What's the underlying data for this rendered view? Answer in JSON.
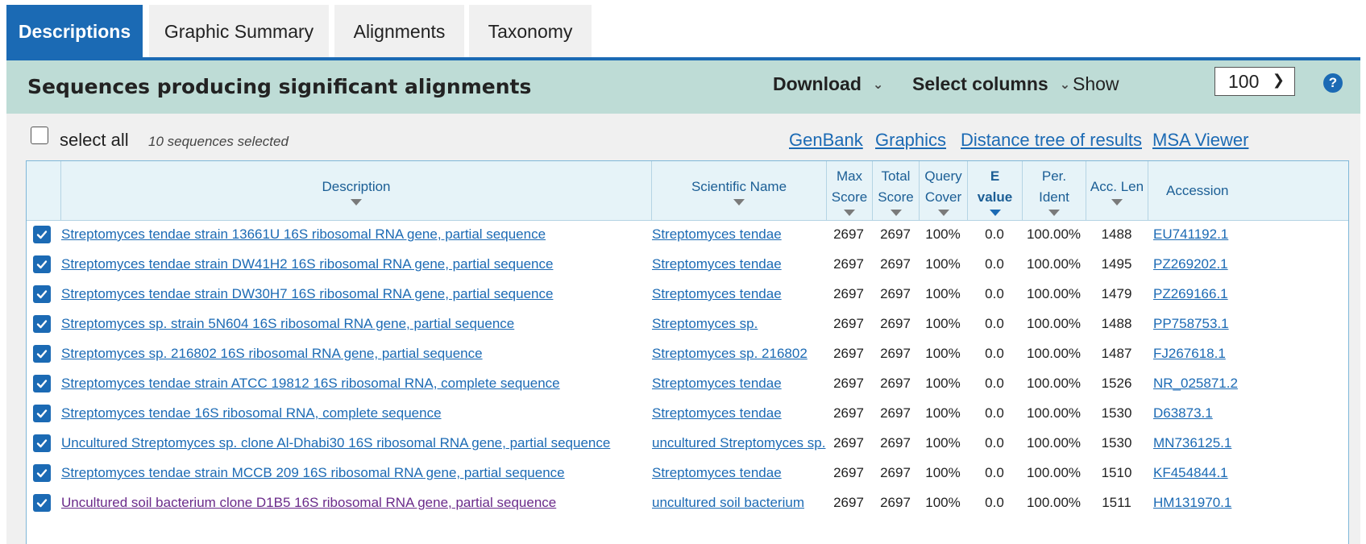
{
  "tabs": [
    "Descriptions",
    "Graphic Summary",
    "Alignments",
    "Taxonomy"
  ],
  "header": {
    "title": "Sequences producing significant alignments",
    "download_label": "Download",
    "select_columns_label": "Select columns",
    "show_label": "Show",
    "show_value": "100",
    "help_glyph": "?"
  },
  "selection": {
    "select_all_label": "select all",
    "selected_count": "10 sequences selected"
  },
  "links": [
    "GenBank",
    "Graphics",
    "Distance tree of results",
    "MSA Viewer"
  ],
  "columns": {
    "description": "Description",
    "scientific_name": "Scientific Name",
    "max_score_1": "Max",
    "max_score_2": "Score",
    "total_score_1": "Total",
    "total_score_2": "Score",
    "query_cover_1": "Query",
    "query_cover_2": "Cover",
    "evalue_1": "E",
    "evalue_2": "value",
    "per_ident_1": "Per.",
    "per_ident_2": "Ident",
    "acc_len": "Acc. Len",
    "accession": "Accession"
  },
  "rows": [
    {
      "description": "Streptomyces tendae strain 13661U 16S ribosomal RNA gene, partial sequence",
      "scientific_name": "Streptomyces tendae",
      "max_score": "2697",
      "total_score": "2697",
      "query_cover": "100%",
      "evalue": "0.0",
      "per_ident": "100.00%",
      "acc_len": "1488",
      "accession": "EU741192.1"
    },
    {
      "description": "Streptomyces tendae strain DW41H2 16S ribosomal RNA gene, partial sequence",
      "scientific_name": "Streptomyces tendae",
      "max_score": "2697",
      "total_score": "2697",
      "query_cover": "100%",
      "evalue": "0.0",
      "per_ident": "100.00%",
      "acc_len": "1495",
      "accession": "PZ269202.1"
    },
    {
      "description": "Streptomyces tendae strain DW30H7 16S ribosomal RNA gene, partial sequence",
      "scientific_name": "Streptomyces tendae",
      "max_score": "2697",
      "total_score": "2697",
      "query_cover": "100%",
      "evalue": "0.0",
      "per_ident": "100.00%",
      "acc_len": "1479",
      "accession": "PZ269166.1"
    },
    {
      "description": "Streptomyces sp. strain 5N604 16S ribosomal RNA gene, partial sequence",
      "scientific_name": "Streptomyces sp.",
      "max_score": "2697",
      "total_score": "2697",
      "query_cover": "100%",
      "evalue": "0.0",
      "per_ident": "100.00%",
      "acc_len": "1488",
      "accession": "PP758753.1"
    },
    {
      "description": "Streptomyces sp. 216802 16S ribosomal RNA gene, partial sequence",
      "scientific_name": "Streptomyces sp. 216802",
      "max_score": "2697",
      "total_score": "2697",
      "query_cover": "100%",
      "evalue": "0.0",
      "per_ident": "100.00%",
      "acc_len": "1487",
      "accession": "FJ267618.1"
    },
    {
      "description": "Streptomyces tendae strain ATCC 19812 16S ribosomal RNA, complete sequence",
      "scientific_name": "Streptomyces tendae",
      "max_score": "2697",
      "total_score": "2697",
      "query_cover": "100%",
      "evalue": "0.0",
      "per_ident": "100.00%",
      "acc_len": "1526",
      "accession": "NR_025871.2"
    },
    {
      "description": "Streptomyces tendae 16S ribosomal RNA, complete sequence",
      "scientific_name": "Streptomyces tendae",
      "max_score": "2697",
      "total_score": "2697",
      "query_cover": "100%",
      "evalue": "0.0",
      "per_ident": "100.00%",
      "acc_len": "1530",
      "accession": "D63873.1"
    },
    {
      "description": "Uncultured Streptomyces sp. clone Al-Dhabi30 16S ribosomal RNA gene, partial sequence",
      "scientific_name": "uncultured Streptomyces sp.",
      "max_score": "2697",
      "total_score": "2697",
      "query_cover": "100%",
      "evalue": "0.0",
      "per_ident": "100.00%",
      "acc_len": "1530",
      "accession": "MN736125.1"
    },
    {
      "description": "Streptomyces tendae strain MCCB 209 16S ribosomal RNA gene, partial sequence",
      "scientific_name": "Streptomyces tendae",
      "max_score": "2697",
      "total_score": "2697",
      "query_cover": "100%",
      "evalue": "0.0",
      "per_ident": "100.00%",
      "acc_len": "1510",
      "accession": "KF454844.1"
    },
    {
      "description": "Uncultured soil bacterium clone D1B5 16S ribosomal RNA gene, partial sequence",
      "scientific_name": "uncultured soil bacterium",
      "max_score": "2697",
      "total_score": "2697",
      "query_cover": "100%",
      "evalue": "0.0",
      "per_ident": "100.00%",
      "acc_len": "1511",
      "accession": "HM131970.1",
      "visited": true
    }
  ],
  "colors": {
    "accent": "#1b6ab4",
    "header_band": "#bedcd6",
    "visited_link": "#6a2a8a"
  },
  "icons": {
    "checkbox": "checkmark-icon",
    "sort": "sort-down-icon",
    "help": "help-icon"
  }
}
